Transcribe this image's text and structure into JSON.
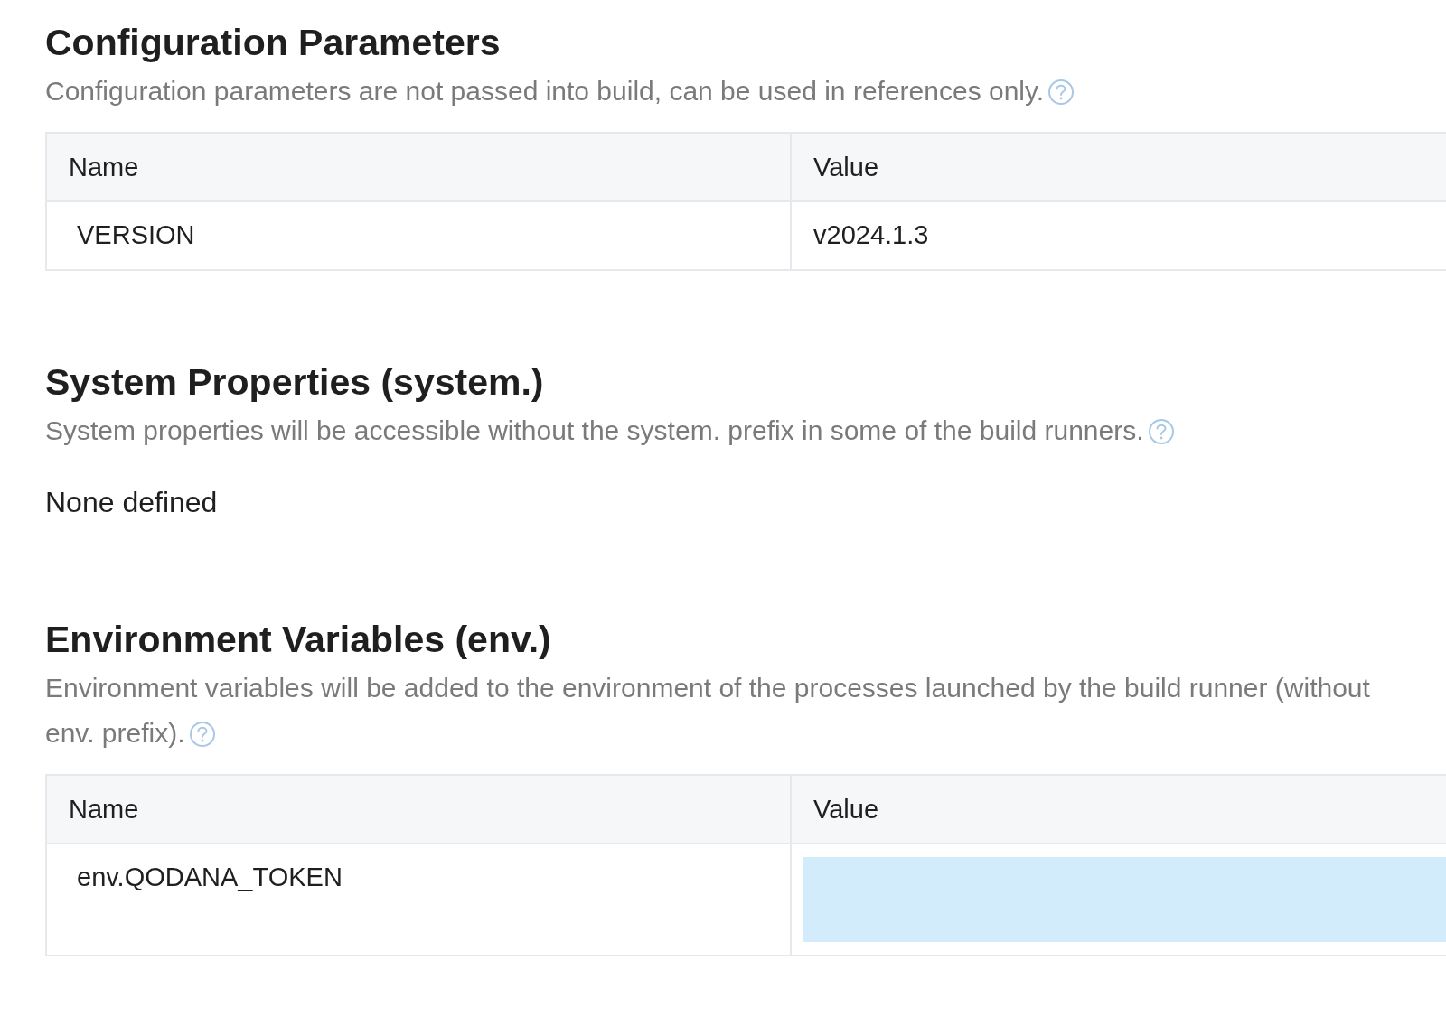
{
  "sections": [
    {
      "title": "Configuration Parameters",
      "description": "Configuration parameters are not passed into build, can be used in references only.",
      "help": true,
      "table": {
        "columns": [
          "Name",
          "Value"
        ],
        "rows": [
          {
            "name": "VERSION",
            "value": "v2024.1.3",
            "masked": false
          }
        ]
      }
    },
    {
      "title": "System Properties (system.)",
      "description": "System properties will be accessible without the system. prefix in some of the build runners.",
      "help": true,
      "empty_text": "None defined"
    },
    {
      "title": "Environment Variables (env.)",
      "description": "Environment variables will be added to the environment of the processes launched by the build runner (without env. prefix).",
      "help": true,
      "table": {
        "columns": [
          "Name",
          "Value"
        ],
        "rows": [
          {
            "name": "env.QODANA_TOKEN",
            "masked": true
          }
        ]
      }
    }
  ]
}
